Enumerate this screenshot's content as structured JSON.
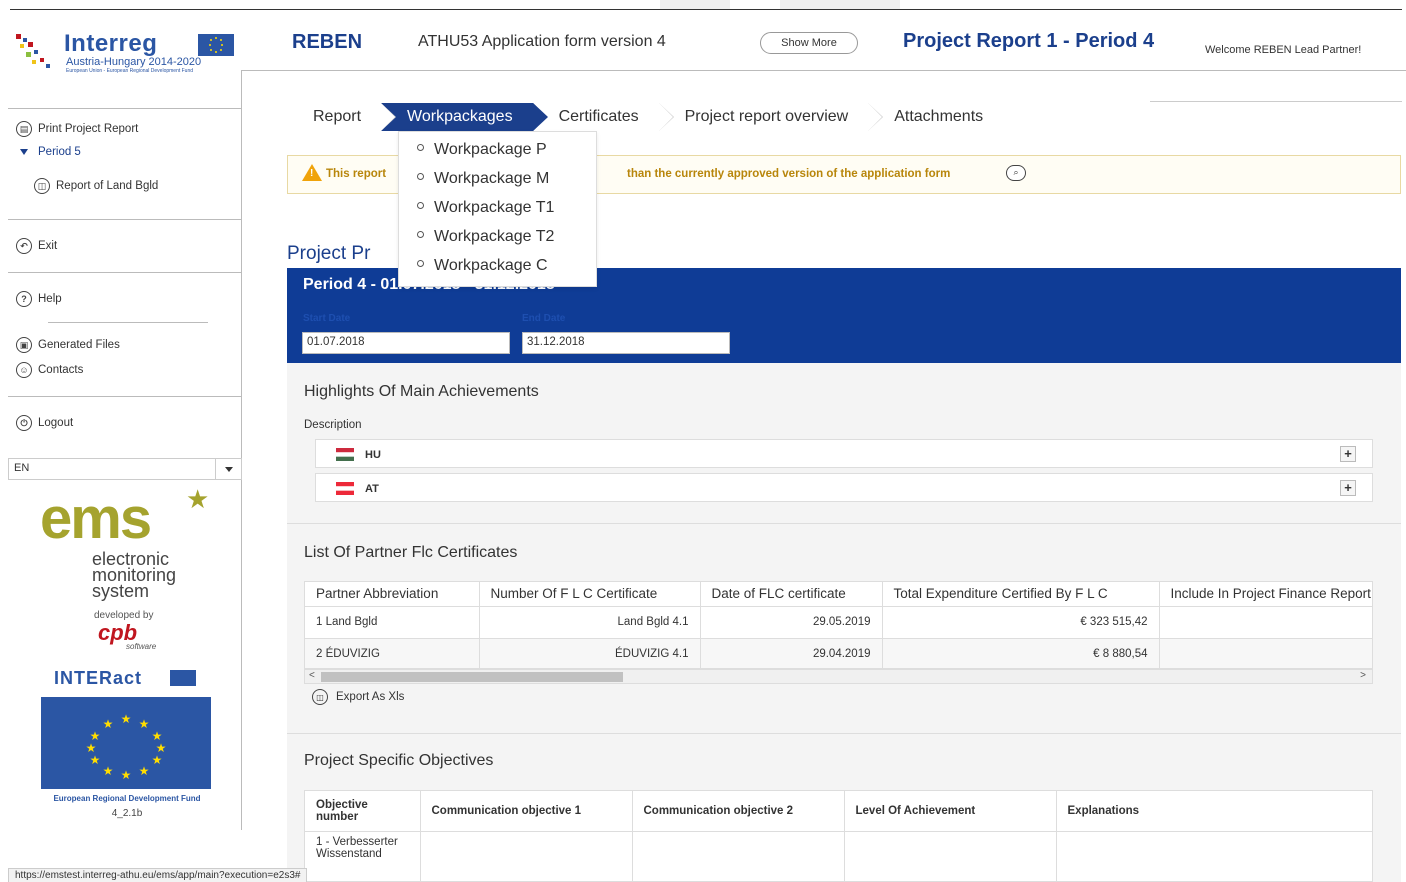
{
  "logo": {
    "brand": "Interreg",
    "subtitle": "Austria-Hungary 2014-2020",
    "tagline": "European Union - European Regional Development Fund"
  },
  "header": {
    "app_name": "REBEN",
    "application_form": "ATHU53 Application form version 4",
    "show_more": "Show More",
    "report_title": "Project Report 1 - Period 4",
    "welcome": "Welcome REBEN Lead Partner!"
  },
  "sidebar": {
    "print": "Print Project Report",
    "period": "Period 5",
    "report_of": "Report of Land Bgld",
    "exit": "Exit",
    "help": "Help",
    "generated_files": "Generated Files",
    "contacts": "Contacts",
    "logout": "Logout",
    "language": "EN",
    "ems_big": "ems",
    "ems_line1": "electronic",
    "ems_line2": "monitoring",
    "ems_line3": "system",
    "developed_by": "developed by",
    "cpb": "cpb",
    "cpb_sub": "software",
    "interact": "INTERact",
    "erdf": "European Regional Development Fund",
    "version": "4_2.1b"
  },
  "tabs": [
    "Report",
    "Workpackages",
    "Certificates",
    "Project report overview",
    "Attachments"
  ],
  "active_tab": "Workpackages",
  "dropdown": [
    "Workpackage P",
    "Workpackage M",
    "Workpackage T1",
    "Workpackage T2",
    "Workpackage C"
  ],
  "warning": {
    "text_start": "This report",
    "text_end": "than the currently approved version of the application form"
  },
  "section_title": "Project Pr",
  "period_panel": {
    "title": "Period 4 - 01.07.2018 - 31.12.2018",
    "start_label": "Start Date",
    "end_label": "End Date",
    "start_value": "01.07.2018",
    "end_value": "31.12.2018"
  },
  "highlights": {
    "title": "Highlights Of Main Achievements",
    "description_label": "Description",
    "languages": [
      {
        "code": "HU",
        "flag": [
          "#cd2a3e",
          "#ffffff",
          "#436f4d"
        ]
      },
      {
        "code": "AT",
        "flag": [
          "#ed2939",
          "#ffffff",
          "#ed2939"
        ]
      }
    ]
  },
  "flc": {
    "title": "List Of Partner Flc Certificates",
    "columns": [
      "Partner Abbreviation",
      "Number Of F L C Certificate",
      "Date of FLC certificate",
      "Total Expenditure Certified By F L C",
      "Include In Project Finance Report"
    ],
    "rows": [
      [
        "1 Land Bgld",
        "Land Bgld 4.1",
        "29.05.2019",
        "€ 323 515,42",
        ""
      ],
      [
        "2 ÉDUVIZIG",
        "ÉDUVIZIG 4.1",
        "29.04.2019",
        "€ 8 880,54",
        ""
      ]
    ],
    "export": "Export As Xls"
  },
  "objectives": {
    "title": "Project Specific Objectives",
    "columns": [
      "Objective number",
      "Communication objective 1",
      "Communication objective 2",
      "Level Of Achievement",
      "Explanations"
    ],
    "first_row": "1 - Verbesserter Wissenstand"
  },
  "status_url": "https://emstest.interreg-athu.eu/ems/app/main?execution=e2s3#",
  "colors": {
    "primary": "#1b3f8c",
    "panel": "#0f3c96",
    "warning": "#b8860b",
    "ems_olive": "#a5a32e",
    "cpb_red": "#c0161f"
  }
}
